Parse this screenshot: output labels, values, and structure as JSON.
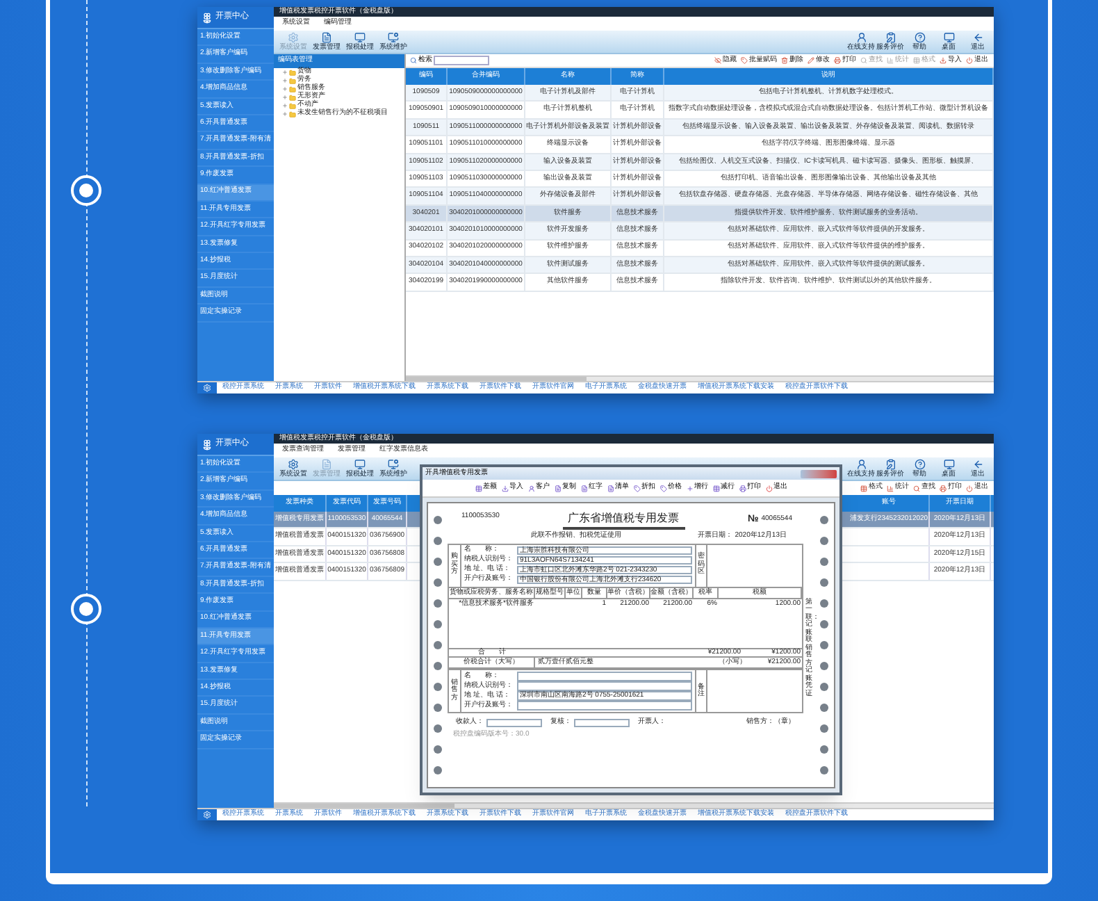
{
  "shots": [
    {
      "kind": "codes",
      "app_title": "增值税发票税控开票软件（金税盘版）",
      "brand": "开票中心",
      "nav": [
        {
          "label": "1.初始化设置",
          "selected": false
        },
        {
          "label": "2.新增客户编码",
          "selected": false
        },
        {
          "label": "3.修改删除客户编码",
          "selected": false
        },
        {
          "label": "4.增加商品信息",
          "selected": false
        },
        {
          "label": "5.发票读入",
          "selected": false
        },
        {
          "label": "6.开具普通发票",
          "selected": false
        },
        {
          "label": "7.开具普通发票-附有清",
          "selected": false
        },
        {
          "label": "8.开具普通发票-折扣",
          "selected": false
        },
        {
          "label": "9.作废发票",
          "selected": false
        },
        {
          "label": "10.红冲普通发票",
          "selected": true
        },
        {
          "label": "11.开具专用发票",
          "selected": false
        },
        {
          "label": "12.开具红字专用发票",
          "selected": false
        },
        {
          "label": "13.发票修复",
          "selected": false
        },
        {
          "label": "14.抄报税",
          "selected": false
        },
        {
          "label": "15.月度统计",
          "selected": false
        },
        {
          "label": "截图说明",
          "selected": false
        },
        {
          "label": "固定实操记录",
          "selected": false
        }
      ],
      "menu": [
        "系统设置",
        "编码管理"
      ],
      "tools": [
        {
          "label": "系统设置",
          "disabled": true
        },
        {
          "label": "发票管理",
          "disabled": false
        },
        {
          "label": "报税处理",
          "disabled": false
        },
        {
          "label": "系统维护",
          "disabled": false
        }
      ],
      "right_tools": [
        "在线支持",
        "服务评价",
        "帮助",
        "桌面",
        "退出"
      ],
      "panel_title": "编码表管理",
      "tree": [
        "货物",
        "劳务",
        "销售服务",
        "无形资产",
        "不动产",
        "未发生销售行为的不征税项目"
      ],
      "search_label": "检索",
      "actions": [
        {
          "label": "隐藏",
          "disabled": false
        },
        {
          "label": "批量赋码",
          "disabled": false
        },
        {
          "label": "删除",
          "disabled": false
        },
        {
          "label": "修改",
          "disabled": false
        },
        {
          "label": "打印",
          "disabled": false
        },
        {
          "label": "查找",
          "disabled": true
        },
        {
          "label": "统计",
          "disabled": true
        },
        {
          "label": "格式",
          "disabled": true
        },
        {
          "label": "导入",
          "disabled": false
        },
        {
          "label": "退出",
          "disabled": false
        }
      ],
      "columns": [
        "编码",
        "合并编码",
        "名称",
        "简称",
        "说明"
      ],
      "rows": [
        {
          "selected": false,
          "cells": [
            "1090509",
            "1090509000000000000",
            "电子计算机及部件",
            "电子计算机",
            "包括电子计算机整机、计算机数字处理模式。"
          ]
        },
        {
          "selected": false,
          "cells": [
            "109050901",
            "1090509010000000000",
            "电子计算机整机",
            "电子计算机",
            "指数字式自动数据处理设备，含模拟式或混合式自动数据处理设备。包括计算机工作站、微型计算机设备"
          ]
        },
        {
          "selected": false,
          "cells": [
            "1090511",
            "1090511000000000000",
            "电子计算机外部设备及装置",
            "计算机外部设备",
            "包括终端显示设备、输入设备及装置、输出设备及装置、外存储设备及装置、阅读机、数据转录"
          ]
        },
        {
          "selected": false,
          "cells": [
            "109051101",
            "1090511010000000000",
            "终端显示设备",
            "计算机外部设备",
            "包括字符/汉字终端、图形图像终端、显示器"
          ]
        },
        {
          "selected": false,
          "cells": [
            "109051102",
            "1090511020000000000",
            "输入设备及装置",
            "计算机外部设备",
            "包括绘图仪、人机交互式设备、扫描仪、IC卡读写机具、磁卡读写器、摄像头、图形板、触摸屏、"
          ]
        },
        {
          "selected": false,
          "cells": [
            "109051103",
            "1090511030000000000",
            "输出设备及装置",
            "计算机外部设备",
            "包括打印机、语音输出设备、图形图像输出设备、其他输出设备及其他"
          ]
        },
        {
          "selected": false,
          "cells": [
            "109051104",
            "1090511040000000000",
            "外存储设备及部件",
            "计算机外部设备",
            "包括软盘存储器、硬盘存储器、光盘存储器、半导体存储器、网络存储设备、磁性存储设备、其他"
          ]
        },
        {
          "selected": true,
          "cells": [
            "3040201",
            "3040201000000000000",
            "软件服务",
            "信息技术服务",
            "指提供软件开发、软件维护服务、软件测试服务的业务活动。"
          ]
        },
        {
          "selected": false,
          "cells": [
            "304020101",
            "3040201010000000000",
            "软件开发服务",
            "信息技术服务",
            "包括对基础软件、应用软件、嵌入式软件等软件提供的开发服务。"
          ]
        },
        {
          "selected": false,
          "cells": [
            "304020102",
            "3040201020000000000",
            "软件维护服务",
            "信息技术服务",
            "包括对基础软件、应用软件、嵌入式软件等软件提供的维护服务。"
          ]
        },
        {
          "selected": false,
          "cells": [
            "304020104",
            "3040201040000000000",
            "软件测试服务",
            "信息技术服务",
            "包括对基础软件、应用软件、嵌入式软件等软件提供的测试服务。"
          ]
        },
        {
          "selected": false,
          "cells": [
            "304020199",
            "3040201990000000000",
            "其他软件服务",
            "信息技术服务",
            "指除软件开发、软件咨询、软件维护、软件测试以外的其他软件服务。"
          ]
        }
      ],
      "links": [
        "税控开票系统",
        "开票系统",
        "开票软件",
        "增值税开票系统下载",
        "开票系统下载",
        "开票软件下载",
        "开票软件官网",
        "电子开票系统",
        "金税盘快速开票",
        "增值税开票系统下载安装",
        "税控盘开票软件下载"
      ]
    },
    {
      "kind": "invoices",
      "app_title": "增值税发票税控开票软件（金税盘版）",
      "brand": "开票中心",
      "nav": [
        {
          "label": "1.初始化设置",
          "selected": false
        },
        {
          "label": "2.新增客户编码",
          "selected": false
        },
        {
          "label": "3.修改删除客户编码",
          "selected": false
        },
        {
          "label": "4.增加商品信息",
          "selected": false
        },
        {
          "label": "5.发票读入",
          "selected": false
        },
        {
          "label": "6.开具普通发票",
          "selected": false
        },
        {
          "label": "7.开具普通发票-附有清",
          "selected": false
        },
        {
          "label": "8.开具普通发票-折扣",
          "selected": false
        },
        {
          "label": "9.作废发票",
          "selected": false
        },
        {
          "label": "10.红冲普通发票",
          "selected": false
        },
        {
          "label": "11.开具专用发票",
          "selected": true
        },
        {
          "label": "12.开具红字专用发票",
          "selected": false
        },
        {
          "label": "13.发票修复",
          "selected": false
        },
        {
          "label": "14.抄报税",
          "selected": false
        },
        {
          "label": "15.月度统计",
          "selected": false
        },
        {
          "label": "截图说明",
          "selected": false
        },
        {
          "label": "固定实操记录",
          "selected": false
        }
      ],
      "menu": [
        "发票查询管理",
        "发票管理",
        "红字发票信息表"
      ],
      "tools": [
        {
          "label": "系统设置",
          "disabled": false
        },
        {
          "label": "发票管理",
          "disabled": true
        },
        {
          "label": "报税处理",
          "disabled": false
        },
        {
          "label": "系统维护",
          "disabled": false
        }
      ],
      "right_tools": [
        "在线支持",
        "服务评价",
        "帮助",
        "桌面",
        "退出"
      ],
      "actions": [
        {
          "label": "格式",
          "disabled": false
        },
        {
          "label": "统计",
          "disabled": false
        },
        {
          "label": "查找",
          "disabled": false
        },
        {
          "label": "打印",
          "disabled": false
        },
        {
          "label": "退出",
          "disabled": false
        }
      ],
      "columns": [
        "发票种类",
        "发票代码",
        "发票号码",
        "账号",
        "开票日期"
      ],
      "rows": [
        {
          "selected": true,
          "type": "增值税专用发票",
          "code": "1100053530",
          "number": "40065544",
          "account": "浦发支行2345232012020",
          "date": "2020年12月13日"
        },
        {
          "selected": false,
          "type": "增值税普通发票",
          "code": "0400151320",
          "number": "036756900",
          "date": "2020年12月13日"
        },
        {
          "selected": false,
          "type": "增值税普通发票",
          "code": "0400151320",
          "number": "036756808",
          "date": "2020年12月15日"
        },
        {
          "selected": false,
          "type": "增值税普通发票",
          "code": "0400151320",
          "number": "036756809",
          "date": "2020年12月13日"
        }
      ],
      "dialog": {
        "title": "开具增值税专用发票",
        "tools": [
          "差额",
          "导入",
          "客户",
          "复制",
          "红字",
          "清单",
          "折扣",
          "价格",
          "增行",
          "减行",
          "打印",
          "退出"
        ],
        "code": "1100053530",
        "title_text": "广东省增值税专用发票",
        "no_mark": "№",
        "number": "40065544",
        "note": "此联不作报销、扣税凭证使用",
        "date_label": "开票日期：",
        "date": "2020年12月13日",
        "buyer_side": "购买方",
        "buyer_fields": [
          {
            "label": "名　　称：",
            "value": "上海崇胜科技有限公司"
          },
          {
            "label": "纳税人识别号：",
            "value": "91L3AOFN64S7134241"
          },
          {
            "label": "地 址、电 话：",
            "value": "上海市虹口区北外滩东华路2号 021-2343230"
          },
          {
            "label": "开户行及账号：",
            "value": "中国银行股份有限公司上海北外滩支行234620"
          }
        ],
        "password_side": "密码区",
        "item_headers": [
          "货物或应税劳务、服务名称",
          "规格型号",
          "单位",
          "数量",
          "单价（含税）",
          "金额（含税）",
          "税率",
          "税额"
        ],
        "items": [
          {
            "name": "*信息技术服务*软件服务",
            "quantity": "1",
            "unit_price": "21200.00",
            "amount": "21200.00",
            "tax_rate": "6%",
            "tax": "1200.00"
          }
        ],
        "total_label": "合　　计",
        "total_amount": "¥21200.00",
        "total_tax": "¥1200.00",
        "capital_label": "价税合计（大写）",
        "capital": "贰万壹仟贰佰元整",
        "lower_label": "（小写）",
        "lower": "¥21200.00",
        "seller_side": "销售方",
        "seller_fields": [
          {
            "label": "名　　称："
          },
          {
            "label": "纳税人识别号："
          },
          {
            "label": "地 址、电 话：",
            "value": "深圳市南山区南海路2号 0755-25001621"
          },
          {
            "label": "开户行及账号："
          }
        ],
        "remark_side": "备注",
        "payee": "收款人：",
        "reviewer": "复核：",
        "drawer": "开票人：",
        "seal": "销售方：（章）",
        "side_note": "第一联：记账联销售方记账凭证",
        "version": "税控盘编码版本号：30.0"
      },
      "links": [
        "税控开票系统",
        "开票系统",
        "开票软件",
        "增值税开票系统下载",
        "开票系统下载",
        "开票软件下载",
        "开票软件官网",
        "电子开票系统",
        "金税盘快速开票",
        "增值税开票系统下载安装",
        "税控盘开票软件下载"
      ]
    }
  ]
}
